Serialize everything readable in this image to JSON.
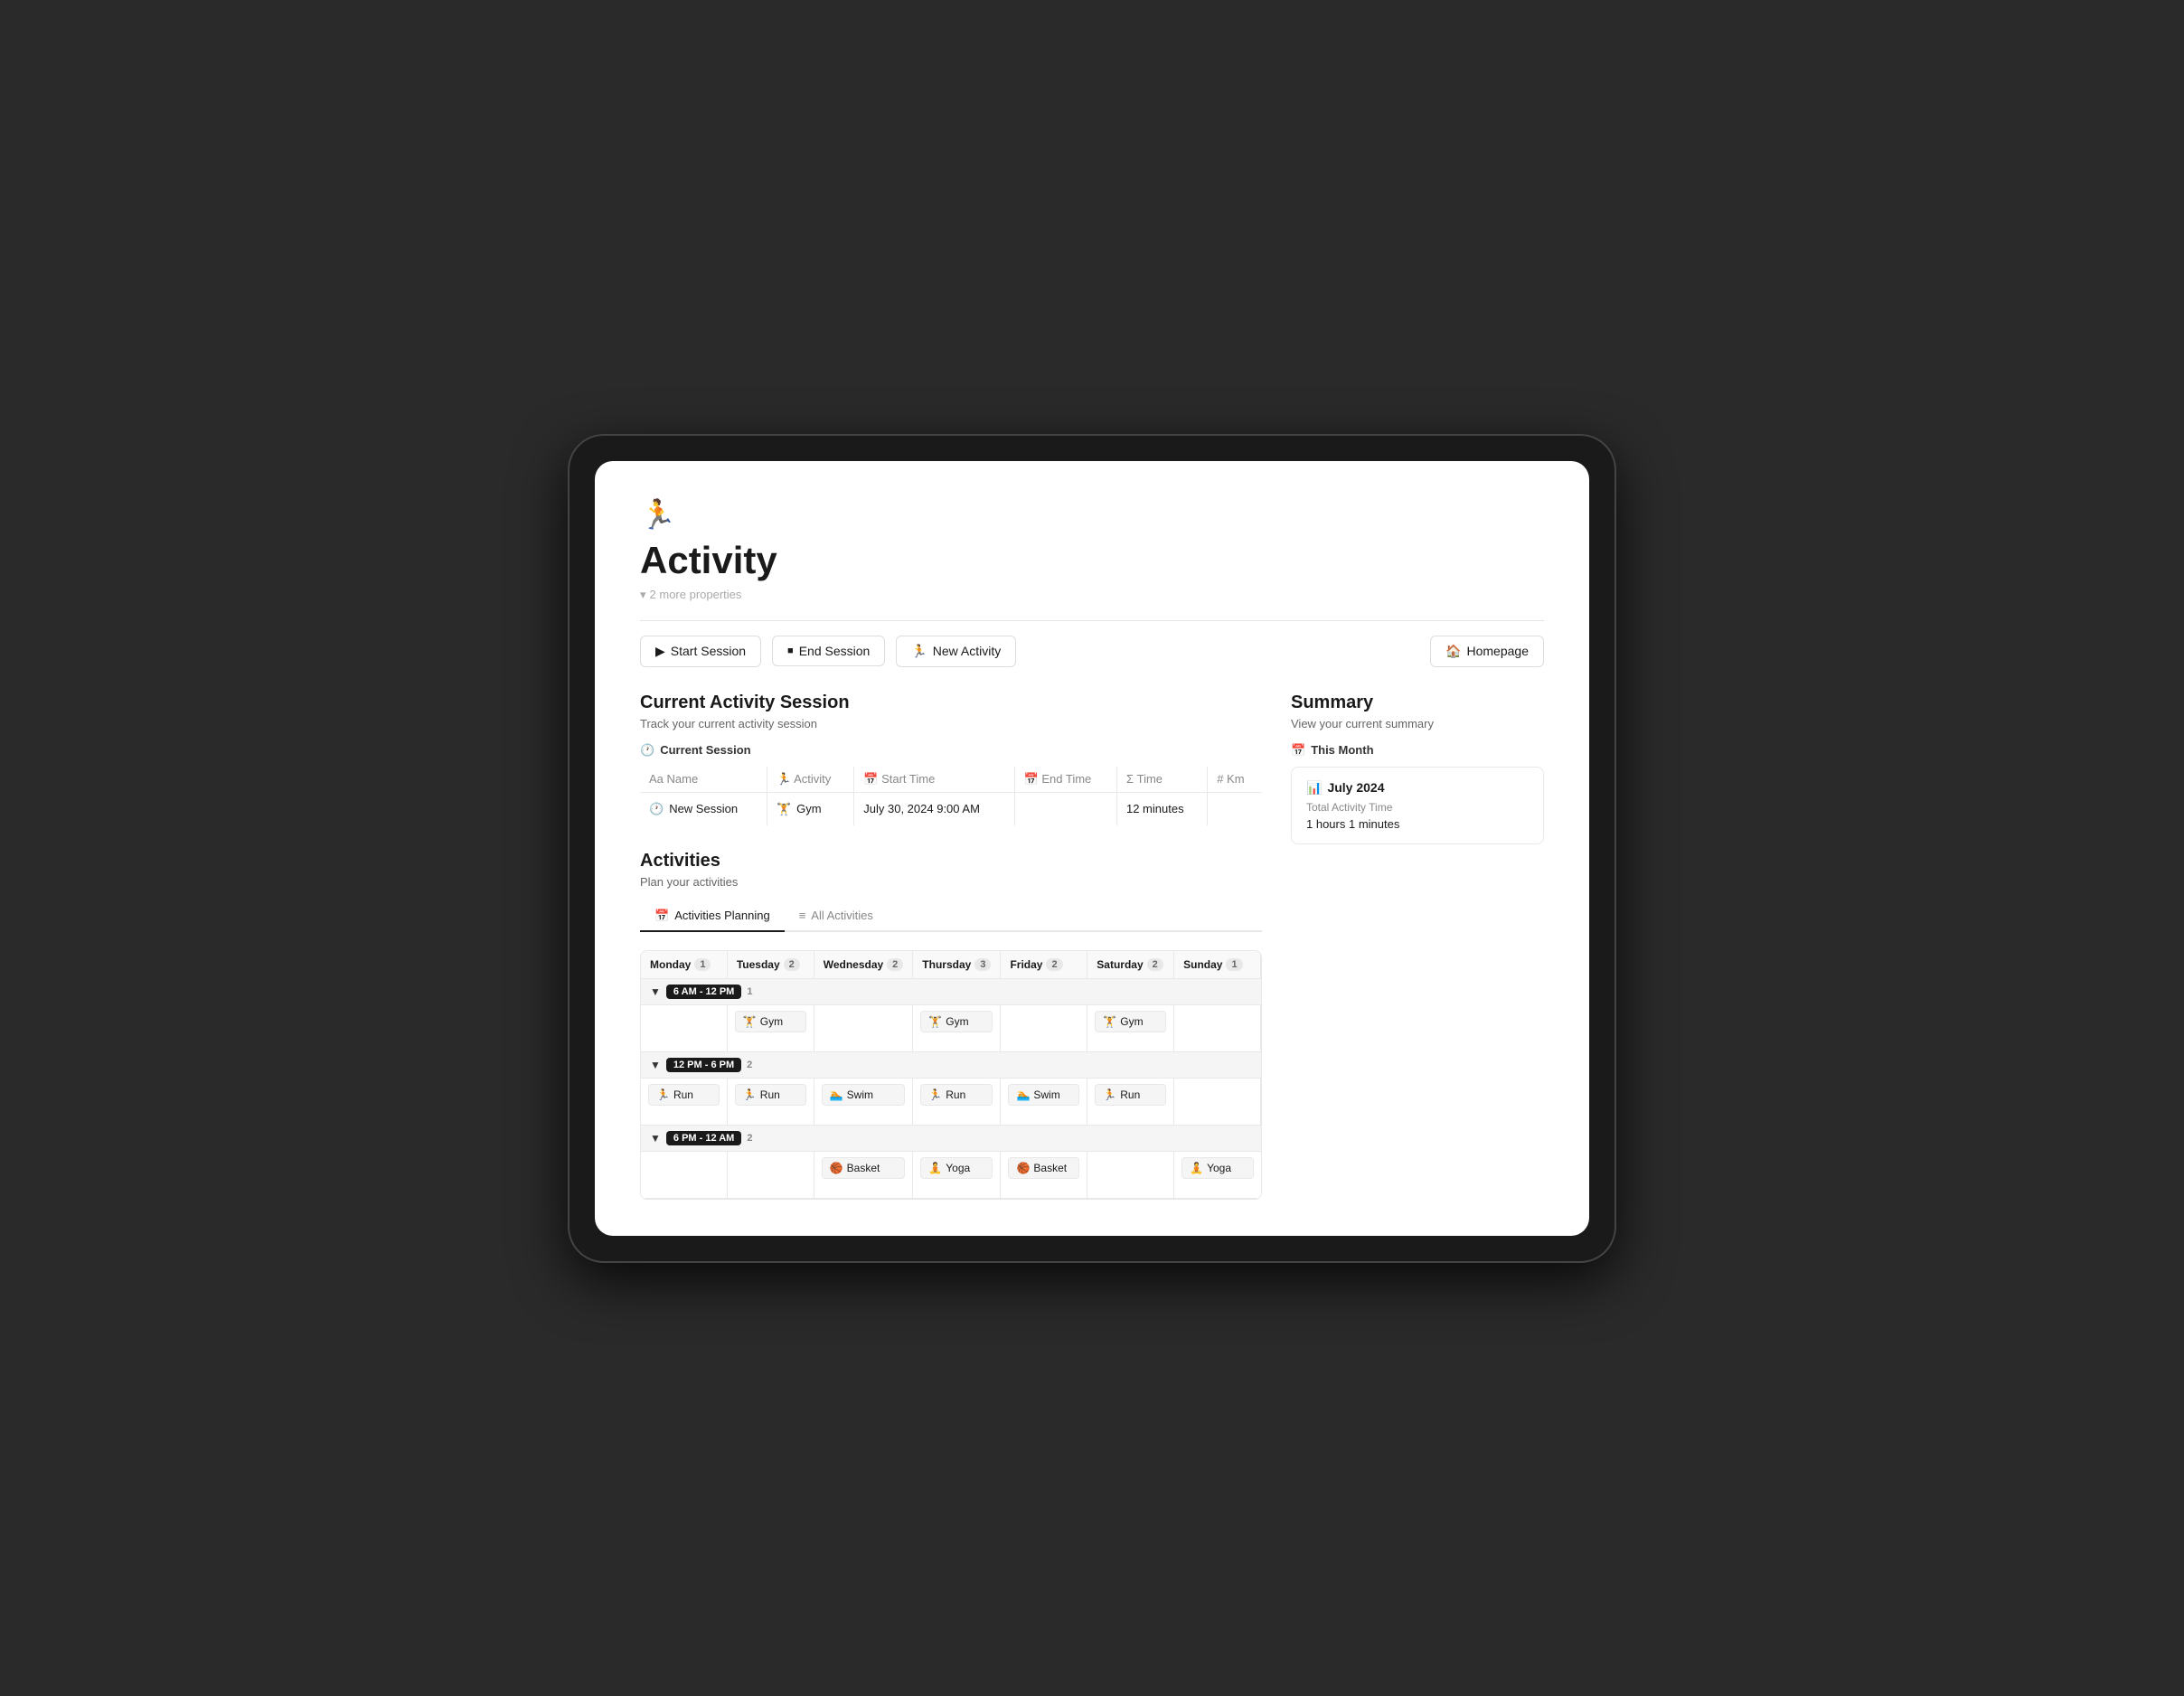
{
  "page": {
    "icon": "🏃",
    "title": "Activity",
    "more_properties": "2 more properties"
  },
  "action_bar": {
    "start_session": "Start Session",
    "end_session": "End Session",
    "new_activity": "New Activity",
    "homepage": "Homepage"
  },
  "current_session": {
    "title": "Current Activity Session",
    "subtitle": "Track your current activity session",
    "label": "Current Session",
    "table": {
      "columns": [
        "Aa Name",
        "Activity",
        "Start Time",
        "End Time",
        "Σ Time",
        "# Km"
      ],
      "row": {
        "name": "New Session",
        "activity": "Gym",
        "start_time": "July 30, 2024 9:00 AM",
        "end_time": "",
        "time": "12 minutes",
        "km": ""
      }
    }
  },
  "activities": {
    "title": "Activities",
    "subtitle": "Plan your activities",
    "tabs": [
      {
        "label": "Activities Planning",
        "icon": "📅",
        "active": true
      },
      {
        "label": "All Activities",
        "icon": "≡",
        "active": false
      }
    ],
    "days": [
      {
        "name": "Monday",
        "count": 1
      },
      {
        "name": "Tuesday",
        "count": 2
      },
      {
        "name": "Wednesday",
        "count": 2
      },
      {
        "name": "Thursday",
        "count": 3
      },
      {
        "name": "Friday",
        "count": 2
      },
      {
        "name": "Saturday",
        "count": 2
      },
      {
        "name": "Sunday",
        "count": 1
      }
    ],
    "time_slots": [
      {
        "label": "6 AM - 12 PM",
        "count": 1,
        "cells": [
          {
            "day": "Monday",
            "activity": null
          },
          {
            "day": "Tuesday",
            "activity": "Gym",
            "icon": "🏋️"
          },
          {
            "day": "Wednesday",
            "activity": null
          },
          {
            "day": "Thursday",
            "activity": "Gym",
            "icon": "🏋️"
          },
          {
            "day": "Friday",
            "activity": null
          },
          {
            "day": "Saturday",
            "activity": "Gym",
            "icon": "🏋️"
          },
          {
            "day": "Sunday",
            "activity": null
          }
        ]
      },
      {
        "label": "12 PM - 6 PM",
        "count": 2,
        "cells": [
          {
            "day": "Monday",
            "activity": "Run",
            "icon": "🏃"
          },
          {
            "day": "Tuesday",
            "activity": "Run",
            "icon": "🏃"
          },
          {
            "day": "Wednesday",
            "activity": "Swim",
            "icon": "🏊"
          },
          {
            "day": "Thursday",
            "activity": "Run",
            "icon": "🏃"
          },
          {
            "day": "Friday",
            "activity": "Swim",
            "icon": "🏊"
          },
          {
            "day": "Saturday",
            "activity": "Run",
            "icon": "🏃"
          },
          {
            "day": "Sunday",
            "activity": null
          }
        ]
      },
      {
        "label": "6 PM - 12 AM",
        "count": 2,
        "cells": [
          {
            "day": "Monday",
            "activity": null
          },
          {
            "day": "Tuesday",
            "activity": null
          },
          {
            "day": "Wednesday",
            "activity": "Basket",
            "icon": "🏀"
          },
          {
            "day": "Thursday",
            "activity": "Yoga",
            "icon": "🧘"
          },
          {
            "day": "Friday",
            "activity": "Basket",
            "icon": "🏀"
          },
          {
            "day": "Saturday",
            "activity": null
          },
          {
            "day": "Sunday",
            "activity": "Yoga",
            "icon": "🧘"
          }
        ]
      }
    ]
  },
  "summary": {
    "title": "Summary",
    "subtitle": "View your current summary",
    "this_month_label": "This Month",
    "card": {
      "month": "July 2024",
      "total_label": "Total Activity Time",
      "value": "1 hours 1 minutes"
    }
  }
}
